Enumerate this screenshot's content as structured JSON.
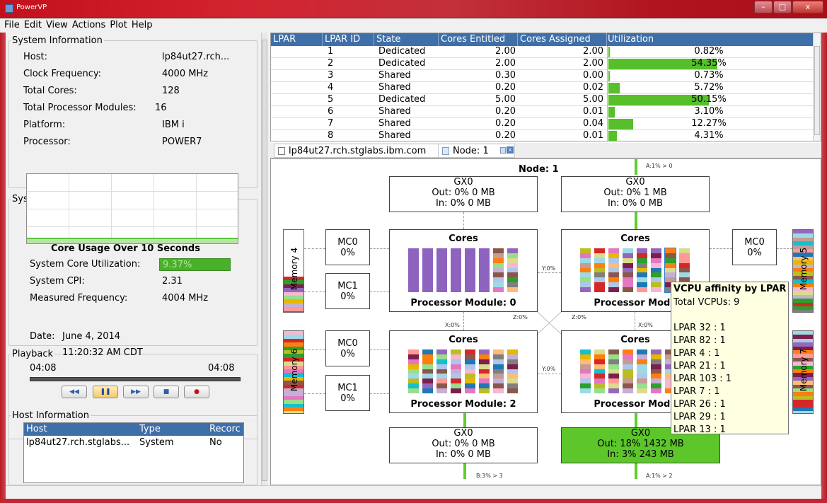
{
  "window": {
    "title": "PowerVP",
    "min": "–",
    "max": "□",
    "close": "x"
  },
  "menu": [
    "File",
    "Edit",
    "View",
    "Actions",
    "Plot",
    "Help"
  ],
  "system_information": {
    "legend": "System Information",
    "rows": [
      {
        "label": "Host:",
        "value": "lp84ut27.rch..."
      },
      {
        "label": "Clock Frequency:",
        "value": "4000 MHz"
      },
      {
        "label": "Total Cores:",
        "value": "128"
      },
      {
        "label": "Total Processor Modules:",
        "value": "16"
      },
      {
        "label": "Platform:",
        "value": "IBM i"
      },
      {
        "label": "Processor:",
        "value": "POWER7"
      }
    ]
  },
  "system_usage": {
    "legend": "System Usage",
    "chart_title": "Core Usage Over 10 Seconds",
    "core_util_label": "System Core Utilization:",
    "core_util_value": "9.37%",
    "cpi_label": "System CPI:",
    "cpi_value": "2.31",
    "freq_label": "Measured Frequency:",
    "freq_value": "4004 MHz"
  },
  "playback": {
    "legend": "Playback",
    "date_label": "Date:",
    "date": "June 4, 2014",
    "time": "11:20:32 AM CDT",
    "start": "04:08",
    "end": "04:08",
    "buttons": [
      "rewind-icon",
      "pause-icon",
      "fast-forward-icon",
      "stop-icon",
      "record-icon"
    ]
  },
  "host_information": {
    "legend": "Host Information",
    "columns": [
      "Host",
      "Type",
      "Record"
    ],
    "columns_display": [
      "Host",
      "Type",
      "Recorc"
    ],
    "rows": [
      [
        "lp84ut27.rch.stglabs...",
        "System",
        "No"
      ]
    ]
  },
  "lpar_table": {
    "columns": [
      "LPAR",
      "LPAR ID",
      "State",
      "Cores Entitled",
      "Cores Assigned",
      "Utilization"
    ],
    "rows": [
      {
        "id": "1",
        "state": "Dedicated",
        "entitled": "2.00",
        "assigned": "2.00",
        "util": "0.82%",
        "util_value": 0.82
      },
      {
        "id": "2",
        "state": "Dedicated",
        "entitled": "2.00",
        "assigned": "2.00",
        "util": "54.35%",
        "util_value": 54.35
      },
      {
        "id": "3",
        "state": "Shared",
        "entitled": "0.30",
        "assigned": "0.00",
        "util": "0.73%",
        "util_value": 0.73
      },
      {
        "id": "4",
        "state": "Shared",
        "entitled": "0.20",
        "assigned": "0.02",
        "util": "5.72%",
        "util_value": 5.72
      },
      {
        "id": "5",
        "state": "Dedicated",
        "entitled": "5.00",
        "assigned": "5.00",
        "util": "50.15%",
        "util_value": 50.15
      },
      {
        "id": "6",
        "state": "Shared",
        "entitled": "0.20",
        "assigned": "0.01",
        "util": "3.10%",
        "util_value": 3.1
      },
      {
        "id": "7",
        "state": "Shared",
        "entitled": "0.20",
        "assigned": "0.04",
        "util": "12.27%",
        "util_value": 12.27
      },
      {
        "id": "8",
        "state": "Shared",
        "entitled": "0.20",
        "assigned": "0.01",
        "util": "4.31%",
        "util_value": 4.31
      }
    ]
  },
  "tabs": [
    {
      "label": "lp84ut27.rch.stglabs.ibm.com"
    },
    {
      "label": "Node: 1"
    }
  ],
  "node": {
    "title": "Node: 1",
    "top_link": "A:1% > 0",
    "bottom_links": [
      "B:3% > 3",
      "A:1% > 2"
    ],
    "gx_top_left": {
      "name": "GX0",
      "out": "Out: 0% 0 MB",
      "in": "In: 0% 0 MB"
    },
    "gx_top_right": {
      "name": "GX0",
      "out": "Out: 0% 1 MB",
      "in": "In: 0% 0 MB"
    },
    "gx_bottom_left": {
      "name": "GX0",
      "out": "Out: 0% 0 MB",
      "in": "In: 0% 0 MB"
    },
    "gx_bottom_right": {
      "name": "GX0",
      "out": "Out: 18% 1432 MB",
      "in": "In: 3% 243 MB"
    },
    "mc": [
      {
        "name": "MC0",
        "value": "0%"
      },
      {
        "name": "MC1",
        "value": "0%"
      },
      {
        "name": "MC0",
        "value": "0%"
      },
      {
        "name": "MC1",
        "value": "0%"
      },
      {
        "name": "MC0",
        "value": "0%"
      }
    ],
    "cores_label": "Cores",
    "modules": [
      "Processor Module: 0",
      "Processor Modu",
      "Processor Module: 2",
      "Processor Modu"
    ],
    "memory": [
      "Memory 4",
      "Memory 5",
      "Memory 6",
      "Memory 7"
    ],
    "links": {
      "y_top": "Y:0%",
      "y_bottom": "Y:0%",
      "x_left": "X:0%",
      "x_right": "X:0%",
      "z_left": "Z:0%",
      "z_right": "Z:0%"
    }
  },
  "tooltip": {
    "title": "VCPU affinity by LPAR",
    "total": "Total VCPUs: 9",
    "items": [
      "LPAR 32 : 1",
      "LPAR 82 : 1",
      "LPAR 4 : 1",
      "LPAR 21 : 1",
      "LPAR 103 : 1",
      "LPAR 7 : 1",
      "LPAR 26 : 1",
      "LPAR 29 : 1",
      "LPAR 13 : 1"
    ]
  },
  "colors": {
    "accent": "#3f6fa8",
    "utilization_bar": "#56bf2a",
    "highlight_gx": "#5cc62b",
    "lpar2_purple": "#8e63bf"
  }
}
